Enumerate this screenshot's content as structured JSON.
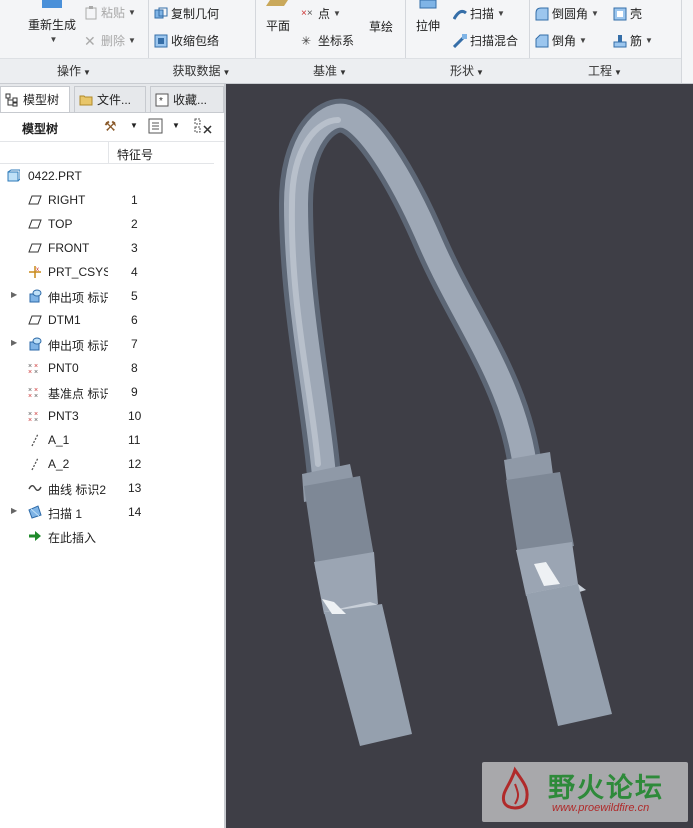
{
  "ribbon": {
    "groups": [
      {
        "label": "操作",
        "buttons": {
          "regenerate": "重新生成",
          "paste": "粘贴",
          "delete": "删除"
        }
      },
      {
        "label": "获取数据",
        "buttons": {
          "copy_geometry": "复制几何",
          "shrinkwrap": "收缩包络"
        }
      },
      {
        "label": "基准",
        "buttons": {
          "plane": "平面",
          "point": "点",
          "csys": "坐标系",
          "sketch": "草绘"
        }
      },
      {
        "label": "形状",
        "buttons": {
          "extrude": "拉伸",
          "sweep": "扫描",
          "swept_blend": "扫描混合"
        }
      },
      {
        "label": "工程",
        "buttons": {
          "round": "倒圆角",
          "chamfer": "倒角",
          "shell": "壳",
          "rib": "筋"
        }
      }
    ]
  },
  "panel": {
    "tabs": [
      "模型树",
      "文件...",
      "收藏..."
    ],
    "toolbar_title": "模型树",
    "column_header": "特征号",
    "items": [
      {
        "name": "0422.PRT",
        "num": "",
        "icon": "part-icon",
        "expandable": false
      },
      {
        "name": "RIGHT",
        "num": "1",
        "icon": "datum-plane-icon",
        "expandable": false
      },
      {
        "name": "TOP",
        "num": "2",
        "icon": "datum-plane-icon",
        "expandable": false
      },
      {
        "name": "FRONT",
        "num": "3",
        "icon": "datum-plane-icon",
        "expandable": false
      },
      {
        "name": "PRT_CSYS_",
        "num": "4",
        "icon": "csys-icon",
        "expandable": false
      },
      {
        "name": "伸出项 标识",
        "num": "5",
        "icon": "protrusion-icon",
        "expandable": true
      },
      {
        "name": "DTM1",
        "num": "6",
        "icon": "datum-plane-icon",
        "expandable": false
      },
      {
        "name": "伸出项 标识",
        "num": "7",
        "icon": "protrusion-icon",
        "expandable": true
      },
      {
        "name": "PNT0",
        "num": "8",
        "icon": "datum-point-icon",
        "expandable": false
      },
      {
        "name": "基准点 标识",
        "num": "9",
        "icon": "datum-point-icon",
        "expandable": false
      },
      {
        "name": "PNT3",
        "num": "10",
        "icon": "datum-point-icon",
        "expandable": false
      },
      {
        "name": "A_1",
        "num": "11",
        "icon": "datum-axis-icon",
        "expandable": false
      },
      {
        "name": "A_2",
        "num": "12",
        "icon": "datum-axis-icon",
        "expandable": false
      },
      {
        "name": "曲线 标识2",
        "num": "13",
        "icon": "curve-icon",
        "expandable": false
      },
      {
        "name": "扫描 1",
        "num": "14",
        "icon": "sweep-icon",
        "expandable": true
      },
      {
        "name": "在此插入",
        "num": "",
        "icon": "insert-here-icon",
        "expandable": false
      }
    ]
  },
  "watermark": {
    "title": "野火论坛",
    "url": "www.proewildfire.cn"
  },
  "colors": {
    "viewport_bg": "#3e3e46",
    "model_fill": "#9aa5b4",
    "insert_arrow": "#1f8a2b"
  }
}
